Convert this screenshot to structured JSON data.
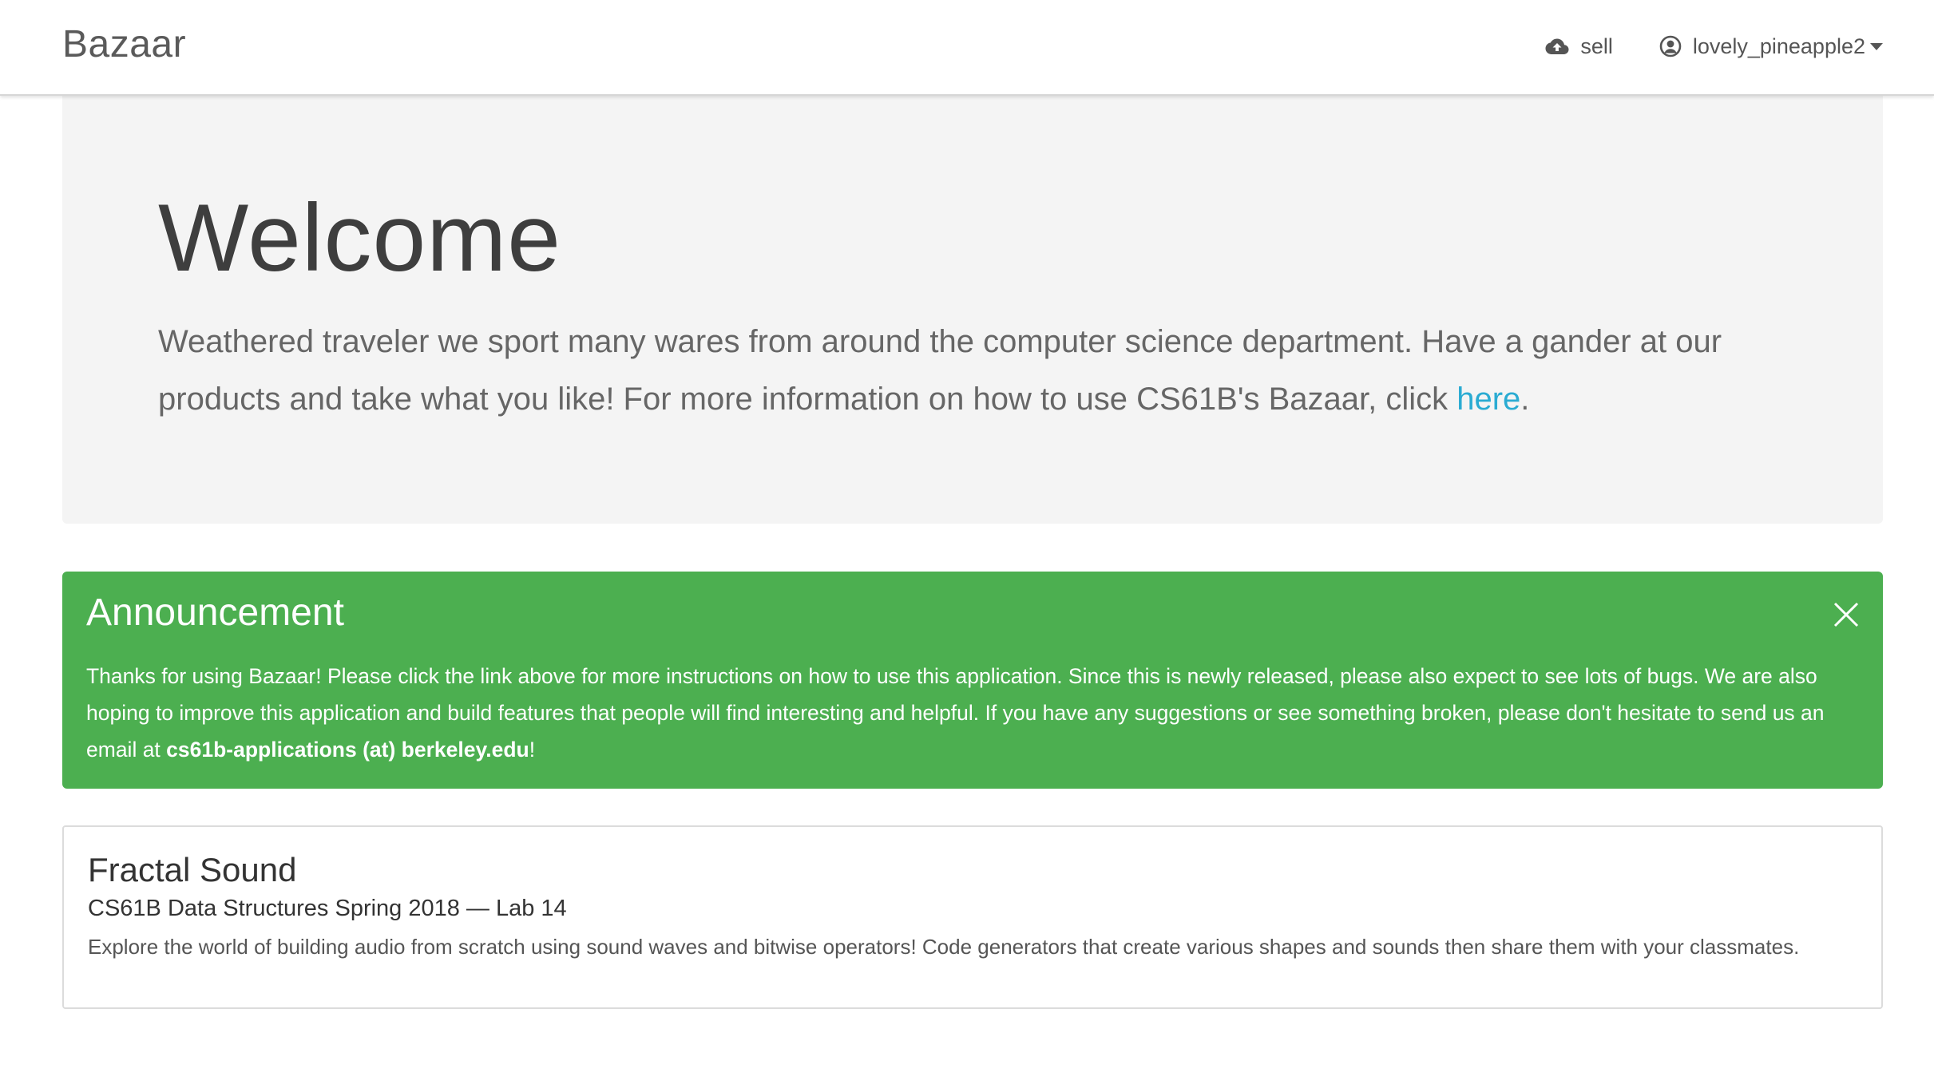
{
  "navbar": {
    "brand": "Bazaar",
    "sell_label": "sell",
    "user_label": "lovely_pineapple2",
    "icons": {
      "sell": "cloud-upload-icon",
      "user": "user-circle-icon",
      "menu": "caret-down-icon"
    }
  },
  "jumbotron": {
    "title": "Welcome",
    "lead_text": "Weathered traveler we sport many wares from around the computer science department. Have a gander at our products and take what you like! For more information on how to use CS61B's Bazaar, click ",
    "link_text": "here",
    "lead_suffix": "."
  },
  "announcement": {
    "title": "Announcement",
    "body": "Thanks for using Bazaar! Please click the link above for more instructions on how to use this application. Since this is newly released, please also expect to see lots of bugs. We are also hoping to improve this application and build features that people will find interesting and helpful. If you have any suggestions or see something broken, please don't hesitate to send us an email at ",
    "email": "cs61b-applications (at) berkeley.edu",
    "suffix": "!",
    "close_icon": "close-icon",
    "color": "#4caf50"
  },
  "products": [
    {
      "title": "Fractal Sound",
      "subtitle": "CS61B Data Structures Spring 2018 — Lab 14",
      "description": "Explore the world of building audio from scratch using sound waves and bitwise operators! Code generators that create various shapes and sounds then share them with your classmates."
    }
  ],
  "colors": {
    "link": "#2aabd2",
    "jumbotron_bg": "#f4f4f4",
    "announcement_bg": "#4caf50"
  }
}
